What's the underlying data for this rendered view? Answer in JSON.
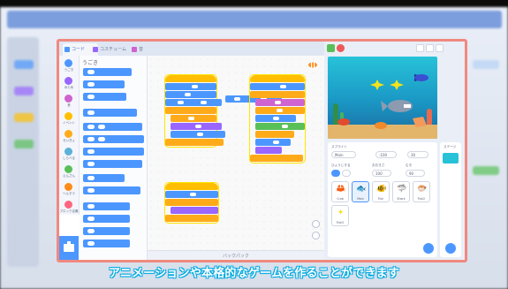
{
  "tabs": [
    {
      "label": "コード",
      "active": true,
      "icon": "code-icon"
    },
    {
      "label": "コスチューム",
      "active": false,
      "icon": "brush-icon"
    },
    {
      "label": "音",
      "active": false,
      "icon": "sound-icon"
    }
  ],
  "categories": [
    {
      "label": "うごき",
      "color": "#4c97ff"
    },
    {
      "label": "みため",
      "color": "#9966ff"
    },
    {
      "label": "音",
      "color": "#cf63cf"
    },
    {
      "label": "イベント",
      "color": "#ffbf00"
    },
    {
      "label": "せいぎょ",
      "color": "#ffab19"
    },
    {
      "label": "しらべる",
      "color": "#5cb1d6"
    },
    {
      "label": "えんざん",
      "color": "#59c059"
    },
    {
      "label": "へんすう",
      "color": "#ff8c1a"
    },
    {
      "label": "ブロック定義",
      "color": "#ff6680"
    }
  ],
  "palette": {
    "title": "うごき"
  },
  "sprite_info": {
    "sprite_label": "スプライト",
    "sprite_name": "Main",
    "show_label": "ひょうじする",
    "size_label": "おおきさ",
    "direction_label": "むき",
    "x_value": "-100",
    "y_value": "30",
    "size_value": "100",
    "direction_value": "90"
  },
  "sprites": [
    {
      "name": "Crab",
      "glyph": "🦀",
      "selected": false
    },
    {
      "name": "Main",
      "glyph": "🐟",
      "selected": true
    },
    {
      "name": "Fish",
      "glyph": "🐠",
      "selected": false
    },
    {
      "name": "Shark",
      "glyph": "🦈",
      "selected": false
    },
    {
      "name": "Fish2",
      "glyph": "🐡",
      "selected": false
    },
    {
      "name": "Fish3",
      "glyph": "✦",
      "selected": false
    }
  ],
  "stage_label": "ステージ",
  "backpack_label": "バックパック",
  "subtitle": "アニメーションや本格的なゲームを作ることができます",
  "colors": {
    "frame_border": "#f0897f",
    "subtitle_outline": "#00a9e0",
    "motion": "#4c97ff",
    "events": "#ffbf00"
  }
}
